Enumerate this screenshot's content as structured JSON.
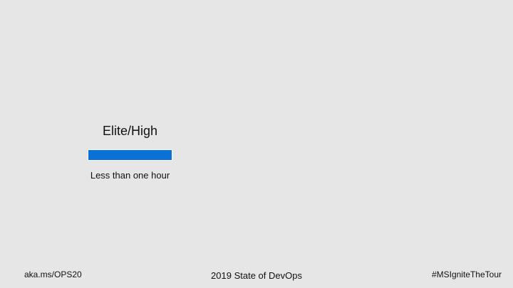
{
  "slide": {
    "tier": {
      "title": "Elite/High",
      "value": "Less than one hour",
      "bar_color": "#0a72d6"
    },
    "footer": {
      "left": "aka.ms/OPS20",
      "center": "2019 State of DevOps",
      "right": "#MSIgniteTheTour"
    }
  }
}
